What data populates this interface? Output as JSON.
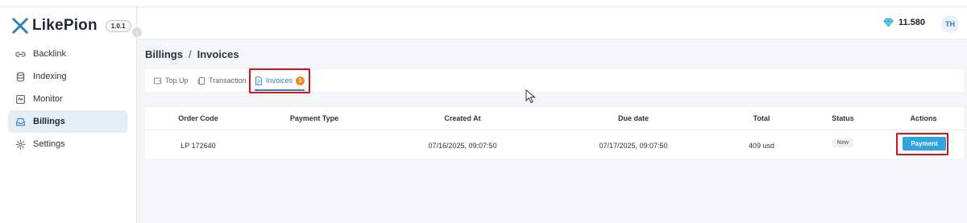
{
  "app": {
    "name": "LikePion",
    "version": "1.0.1"
  },
  "sidebar": {
    "items": [
      {
        "label": "Backlink",
        "icon": "link-icon",
        "active": false
      },
      {
        "label": "Indexing",
        "icon": "database-icon",
        "active": false
      },
      {
        "label": "Monitor",
        "icon": "monitor-icon",
        "active": false
      },
      {
        "label": "Billings",
        "icon": "inbox-icon",
        "active": true
      },
      {
        "label": "Settings",
        "icon": "gear-icon",
        "active": false
      }
    ]
  },
  "header": {
    "balance": "11.580",
    "balance_icon": "diamond-icon",
    "avatar_initials": "TH"
  },
  "breadcrumb": {
    "parent": "Billings",
    "separator": "/",
    "current": "Invoices"
  },
  "tabs": [
    {
      "label": "Top Up",
      "icon": "wallet-icon",
      "active": false
    },
    {
      "label": "Transaction",
      "icon": "copy-icon",
      "active": false
    },
    {
      "label": "Invoices",
      "icon": "document-icon",
      "active": true,
      "badge": "1"
    }
  ],
  "table": {
    "columns": [
      "Order Code",
      "Payment Type",
      "Created At",
      "Due date",
      "Total",
      "Status",
      "Actions"
    ],
    "rows": [
      {
        "order_code": "LP 172640",
        "payment_type": "",
        "created_at": "07/16/2025, 09:07:50",
        "due_date": "07/17/2025, 09:07:50",
        "total": "409 usd",
        "status": "New",
        "action": "Payment"
      }
    ]
  },
  "colors": {
    "accent": "#2f80c2",
    "highlight": "#d4131a",
    "badge": "#ef8a23",
    "button": "#2fa4de"
  }
}
